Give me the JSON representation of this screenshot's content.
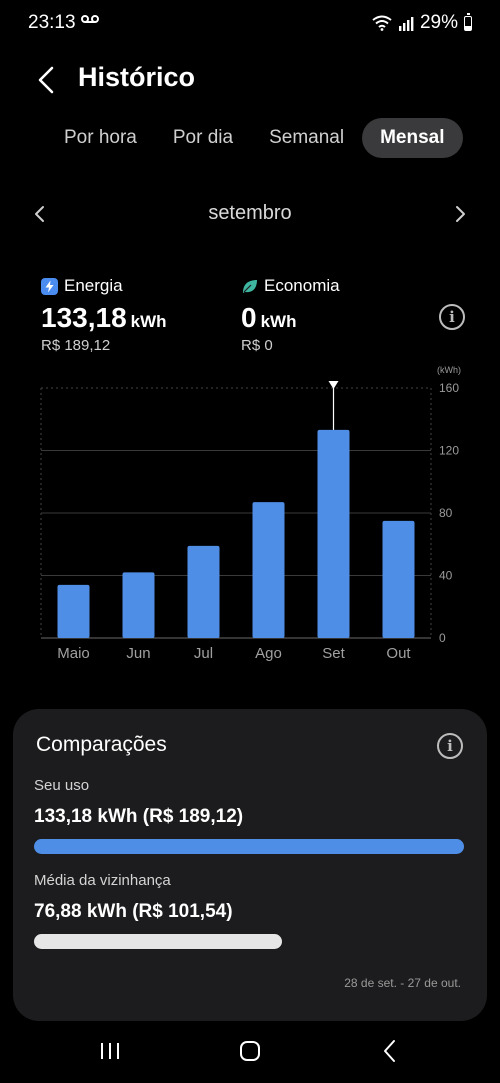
{
  "status": {
    "time": "23:13",
    "battery": "29%"
  },
  "header": {
    "title": "Histórico"
  },
  "tabs": [
    {
      "label": "Por hora",
      "active": false
    },
    {
      "label": "Por dia",
      "active": false
    },
    {
      "label": "Semanal",
      "active": false
    },
    {
      "label": "Mensal",
      "active": true
    }
  ],
  "period": {
    "label": "setembro"
  },
  "stats": {
    "energy": {
      "label": "Energia",
      "value": "133,18",
      "unit": "kWh",
      "cost": "R$ 189,12",
      "icon": "lightning-icon",
      "color": "#4a8cf0"
    },
    "savings": {
      "label": "Economia",
      "value": "0",
      "unit": "kWh",
      "cost": "R$ 0",
      "icon": "leaf-icon",
      "color": "#3fb6a0"
    }
  },
  "chart_data": {
    "type": "bar",
    "categories": [
      "Maio",
      "Jun",
      "Jul",
      "Ago",
      "Set",
      "Out"
    ],
    "values": [
      34,
      42,
      59,
      87,
      133.18,
      75
    ],
    "unit_label": "(kWh)",
    "yticks": [
      0,
      40,
      80,
      120,
      160
    ],
    "ylim": [
      0,
      160
    ],
    "selected": "Set",
    "bar_color": "#4f8ee6",
    "grid": true
  },
  "comparisons": {
    "title": "Comparações",
    "yours": {
      "label": "Seu uso",
      "value": "133,18 kWh (R$ 189,12)",
      "fraction": 1.0,
      "color": "#4f8ee6"
    },
    "neighborhood": {
      "label": "Média da vizinhança",
      "value": "76,88 kWh (R$ 101,54)",
      "fraction": 0.577,
      "color": "#e6e6e6"
    },
    "date_range": "28 de set. - 27 de out."
  }
}
